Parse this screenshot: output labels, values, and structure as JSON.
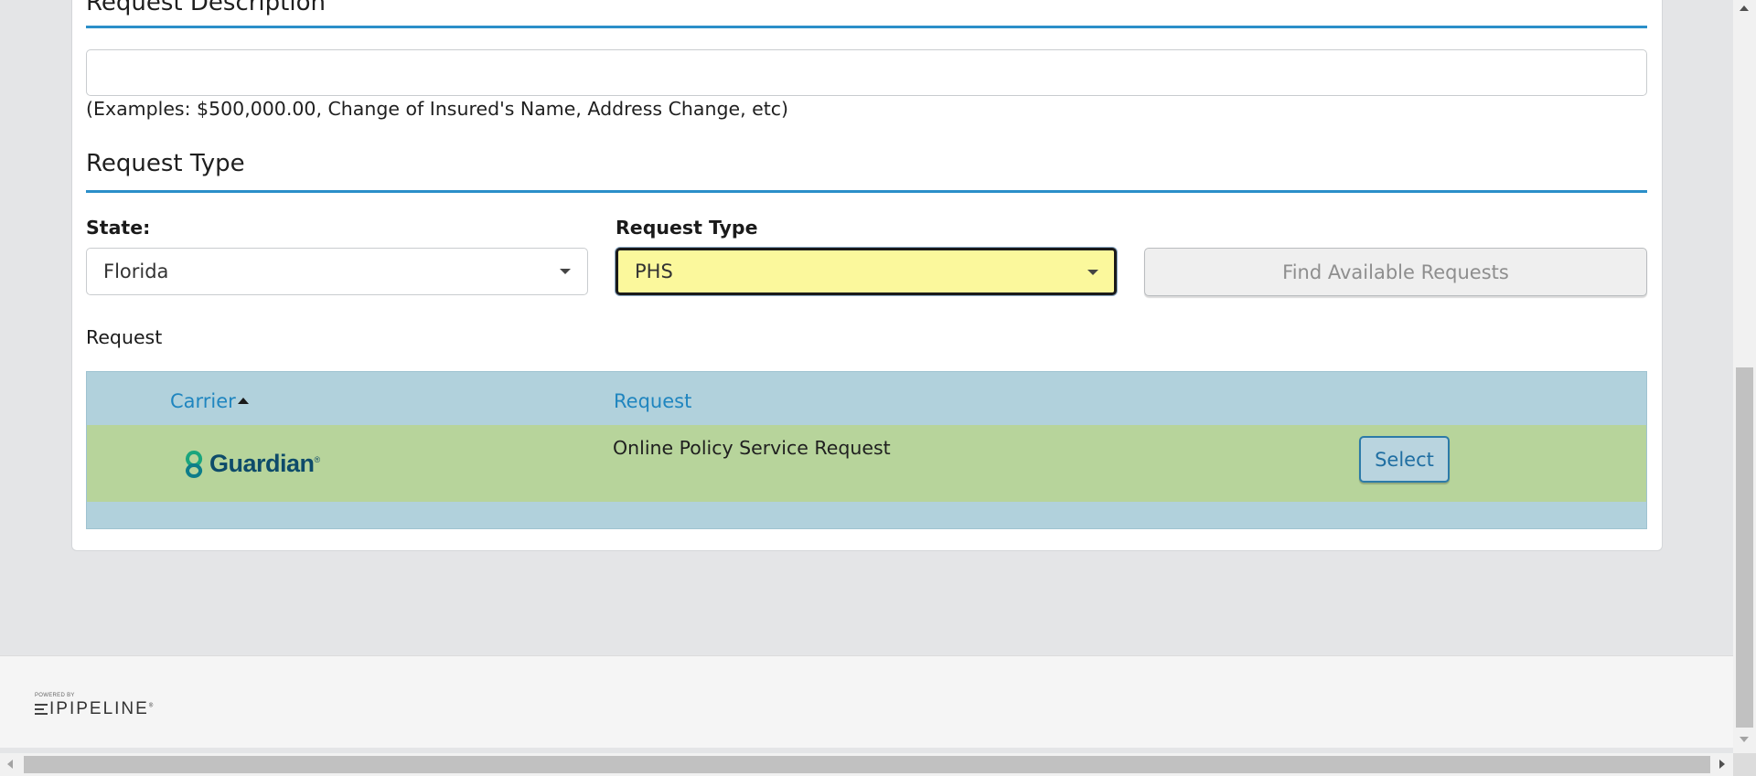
{
  "description_section": {
    "heading": "Request Description",
    "input_value": "",
    "hint": "(Examples: $500,000.00, Change of Insured's Name, Address Change, etc)"
  },
  "request_type_section": {
    "heading": "Request Type",
    "state_label": "State:",
    "state_value": "Florida",
    "type_label": "Request Type",
    "type_value": "PHS",
    "find_button": "Find Available Requests"
  },
  "results": {
    "label": "Request",
    "columns": {
      "carrier": "Carrier",
      "request": "Request"
    },
    "rows": [
      {
        "carrier": "Guardian",
        "carrier_mark": "®",
        "request": "Online Policy Service Request",
        "action": "Select"
      }
    ]
  },
  "footer": {
    "powered_by": "POWERED BY",
    "brand": "IPIPELINE",
    "brand_mark": "®"
  },
  "colors": {
    "accent_rule": "#2b8fc9",
    "table_header_bg": "#b1d1dc",
    "row_bg": "#b7d49b",
    "highlight_field": "#fbf89c",
    "link_text": "#1f85bf"
  },
  "icons": [
    "dropdown-caret-icon",
    "sort-ascending-icon",
    "guardian-logo-icon",
    "ipipeline-logo-icon"
  ]
}
